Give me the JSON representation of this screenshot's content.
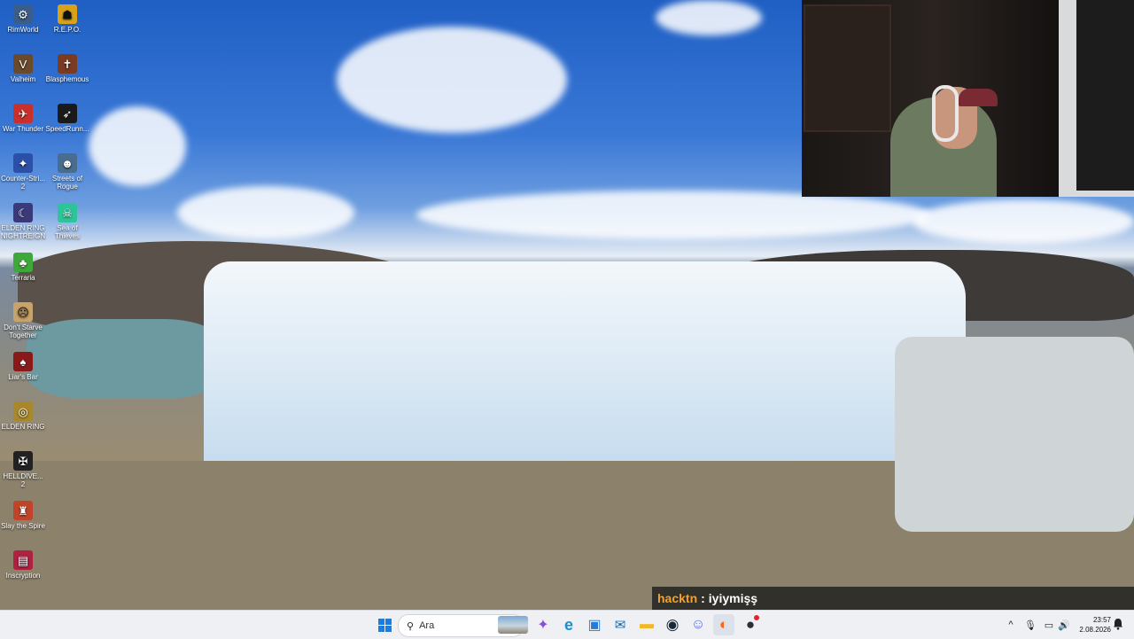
{
  "desktop": {
    "icons": [
      {
        "label": "RimWorld",
        "icon": "rimworld-icon",
        "color": "#3b5d8a"
      },
      {
        "label": "R.E.P.O.",
        "icon": "repo-icon",
        "color": "#d8a21a"
      },
      {
        "label": "Valheim",
        "icon": "valheim-icon",
        "color": "#6b4a2c"
      },
      {
        "label": "Blasphemous",
        "icon": "blasphemous-icon",
        "color": "#7a3b22"
      },
      {
        "label": "War Thunder",
        "icon": "war-thunder-icon",
        "color": "#c9302c"
      },
      {
        "label": "SpeedRunn...",
        "icon": "speedrunners-icon",
        "color": "#1a1a1a"
      },
      {
        "label": "Counter-Stri... 2",
        "icon": "counter-strike-icon",
        "color": "#2c4fa8"
      },
      {
        "label": "Streets of Rogue",
        "icon": "streets-of-rogue-icon",
        "color": "#4a6d8f"
      },
      {
        "label": "ELDEN RING NIGHTREIGN",
        "icon": "elden-ring-nightreign-icon",
        "color": "#3a3a7a"
      },
      {
        "label": "Sea of Thieves",
        "icon": "sea-of-thieves-icon",
        "color": "#2ec49a"
      },
      {
        "label": "Terraria",
        "icon": "terraria-icon",
        "color": "#3fa83a"
      },
      {
        "label": "Don't Starve Together",
        "icon": "dont-starve-icon",
        "color": "#c8a46a"
      },
      {
        "label": "Liar's Bar",
        "icon": "liars-bar-icon",
        "color": "#8a1a1a"
      },
      {
        "label": "ELDEN RING",
        "icon": "elden-ring-icon",
        "color": "#a8882a"
      },
      {
        "label": "HELLDIVE... 2",
        "icon": "helldivers-icon",
        "color": "#222222"
      },
      {
        "label": "Slay the Spire",
        "icon": "slay-the-spire-icon",
        "color": "#c0442a"
      },
      {
        "label": "Inscryption",
        "icon": "inscryption-icon",
        "color": "#b02040"
      }
    ]
  },
  "chat": {
    "user": "hacktn",
    "separator": ":",
    "message": "iyiymişş",
    "user_color": "#f4a12a"
  },
  "taskbar": {
    "search_placeholder": "Ara",
    "pinned": [
      {
        "name": "copilot-icon",
        "glyph": "✦",
        "color": "#8a4fd8"
      },
      {
        "name": "edge-icon",
        "glyph": "e",
        "color": "#1b8fd4"
      },
      {
        "name": "store-icon",
        "glyph": "▣",
        "color": "#2a7ad0"
      },
      {
        "name": "outlook-icon",
        "glyph": "✉",
        "color": "#0f6cbd"
      },
      {
        "name": "file-explorer-icon",
        "glyph": "▬",
        "color": "#f2b926"
      },
      {
        "name": "steam-icon",
        "glyph": "◉",
        "color": "#1b2838"
      },
      {
        "name": "discord-icon",
        "glyph": "☺",
        "color": "#5865f2"
      },
      {
        "name": "firefox-icon",
        "glyph": "◐",
        "color": "#ff6611"
      },
      {
        "name": "obs-icon",
        "glyph": "●",
        "color": "#302e31"
      }
    ],
    "tray": {
      "chevron": "^",
      "mic": "🎙",
      "network": "▭",
      "volume": "🔊"
    },
    "time": "23:57",
    "date": "2.08.2026"
  }
}
